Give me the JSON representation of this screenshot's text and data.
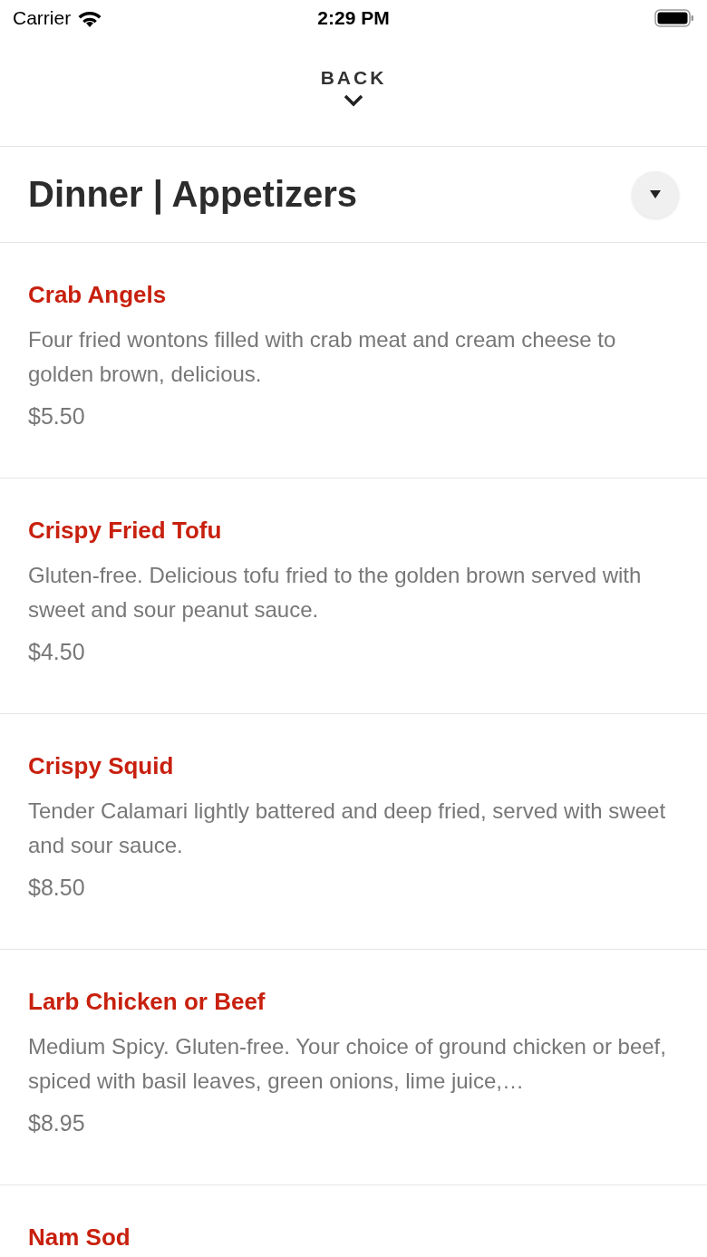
{
  "status_bar": {
    "carrier": "Carrier",
    "time": "2:29 PM"
  },
  "back_button": {
    "label": "BACK"
  },
  "header": {
    "title": "Dinner | Appetizers"
  },
  "items": [
    {
      "name": "Crab Angels",
      "description": "Four fried wontons filled with crab meat and cream cheese to golden brown, delicious.",
      "price": "$5.50"
    },
    {
      "name": "Crispy Fried Tofu",
      "description": "Gluten-free. Delicious tofu fried to the golden brown served with sweet and sour peanut sauce.",
      "price": "$4.50"
    },
    {
      "name": "Crispy Squid",
      "description": "Tender Calamari lightly battered and deep fried, served with sweet and sour sauce.",
      "price": "$8.50"
    },
    {
      "name": "Larb Chicken or Beef",
      "description": "Medium Spicy. Gluten-free. Your choice of ground chicken or beef, spiced with basil leaves, green onions, lime juice,…",
      "price": "$8.95"
    },
    {
      "name": "Nam Sod"
    }
  ]
}
